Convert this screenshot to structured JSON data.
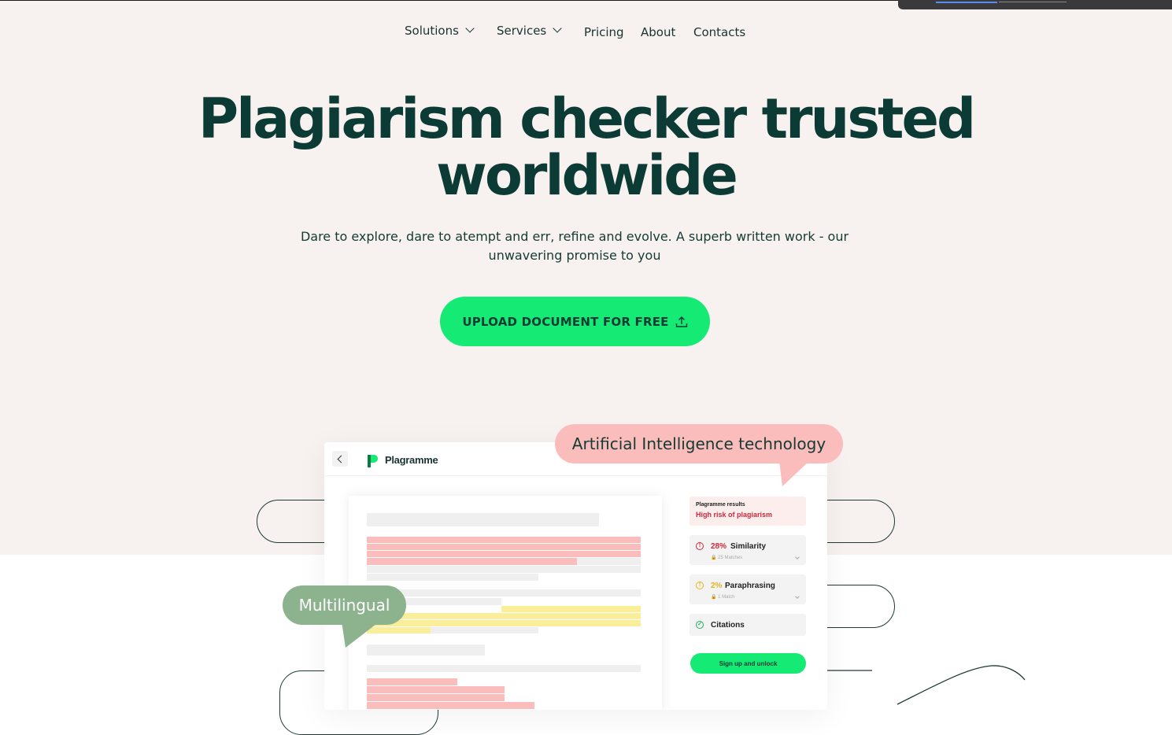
{
  "nav": {
    "items": [
      {
        "label": "Solutions",
        "dropdown": true
      },
      {
        "label": "Services",
        "dropdown": true
      },
      {
        "label": "Pricing"
      },
      {
        "label": "About"
      },
      {
        "label": "Contacts"
      }
    ]
  },
  "hero": {
    "title_line1": "Plagiarism checker trusted",
    "title_line2": "worldwide",
    "subtitle_line1": "Dare to explore, dare to atempt and err, refine and evolve. A superb written work - our",
    "subtitle_line2": "unwavering promise to you",
    "cta_label": "UPLOAD DOCUMENT FOR FREE",
    "cta_icon": "upload-icon"
  },
  "app_preview": {
    "brand": "Plagramme",
    "results_title": "Plagramme results",
    "risk_text": "High risk of plagiarism",
    "similarity": {
      "percent": "28%",
      "label": "Similarity",
      "matches": "25 Matches"
    },
    "paraphrasing": {
      "percent": "2%",
      "label": "Paraphrasing",
      "matches": "1 Match"
    },
    "citations_label": "Citations",
    "unlock_label": "Sign up and unlock"
  },
  "bubbles": {
    "ai": "Artificial Intelligence technology",
    "multilingual": "Multilingual"
  },
  "colors": {
    "accent_green": "#14ea74",
    "text_dark": "#0b3b34",
    "hero_bg": "#f7f2ef",
    "highlight_red": "#fbbcbc",
    "highlight_yellow": "#fbee9a",
    "bubble_green": "#8db38e"
  }
}
